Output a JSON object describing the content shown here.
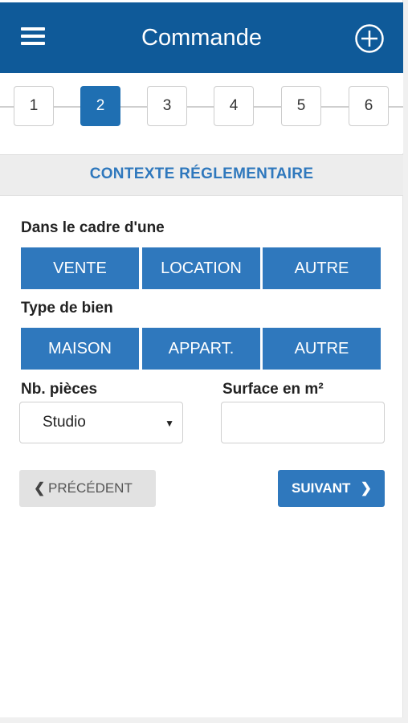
{
  "header": {
    "title": "Commande",
    "menu_icon": "hamburger-menu-icon",
    "add_icon": "plus-circle-icon",
    "bg_color": "#0f5a99"
  },
  "stepper": {
    "steps": [
      "1",
      "2",
      "3",
      "4",
      "5",
      "6"
    ],
    "active_step": "2",
    "active_color": "#1f6fb2"
  },
  "section": {
    "title": "CONTEXTE RÉGLEMENTAIRE",
    "title_color": "#2f78bd"
  },
  "form": {
    "transaction_label": "Dans le cadre d'une",
    "transaction_options": [
      "VENTE",
      "LOCATION",
      "AUTRE"
    ],
    "property_label": "Type de bien",
    "property_options": [
      "MAISON",
      "APPART.",
      "AUTRE"
    ],
    "rooms_label": "Nb. pièces",
    "rooms_value": "Studio",
    "surface_label": "Surface en m²",
    "surface_value": ""
  },
  "nav": {
    "prev_label": "PRÉCÉDENT",
    "next_label": "SUIVANT",
    "button_color": "#2f78bd"
  }
}
